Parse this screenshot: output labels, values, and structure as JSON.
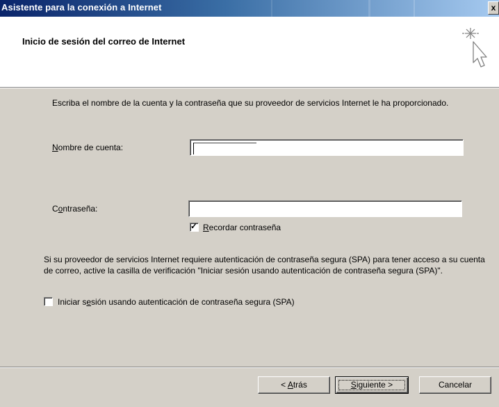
{
  "window": {
    "title": "Asistente para la conexión a Internet",
    "close_label": "x"
  },
  "header": {
    "title": "Inicio de sesión del correo de Internet",
    "icon": "wizard-sparkle-cursor-icon"
  },
  "body": {
    "instructions": "Escriba el nombre de la cuenta y la contraseña que su proveedor de servicios Internet le ha proporcionado.",
    "account_label": {
      "pre": "",
      "key": "N",
      "post": "ombre de cuenta:"
    },
    "account_value": "",
    "password_label": {
      "pre": "C",
      "key": "o",
      "post": "ntraseña:"
    },
    "password_value": "",
    "remember": {
      "pre": "",
      "key": "R",
      "post": "ecordar contraseña",
      "checked": true
    },
    "spa_text": "Si su proveedor de servicios Internet requiere autenticación de contraseña segura (SPA) para tener acceso a su cuenta de correo, active la casilla de verificación \"Iniciar sesión usando autenticación de contraseña segura (SPA)\".",
    "spa_checkbox": {
      "pre": "Iniciar s",
      "key": "e",
      "post": "sión usando autenticación de contraseña segura (SPA)",
      "checked": false
    }
  },
  "buttons": {
    "back": {
      "pre": "< ",
      "key": "A",
      "post": "trás"
    },
    "next": {
      "pre": "",
      "key": "S",
      "post": "iguiente >"
    },
    "cancel": "Cancelar"
  }
}
